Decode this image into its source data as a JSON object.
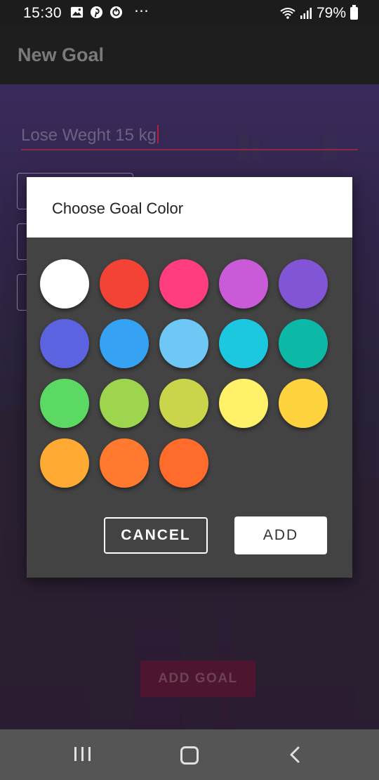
{
  "status_bar": {
    "time": "15:30",
    "dots": "⋯",
    "battery": "79%"
  },
  "app_bar": {
    "title": "New Goal"
  },
  "form": {
    "goal_name_value": "Lose Weght 15 kg",
    "add_goal_label": "ADD GOAL"
  },
  "dialog": {
    "title": "Choose Goal Color",
    "cancel_label": "CANCEL",
    "add_label": "ADD",
    "colors": [
      "#ffffff",
      "#f44336",
      "#ff3d7f",
      "#c95ad8",
      "#8155d6",
      "#5b63e0",
      "#35a2f4",
      "#6ec7f5",
      "#1cc8e0",
      "#0cb8a6",
      "#5bd962",
      "#9dd54f",
      "#cad54a",
      "#fff168",
      "#ffd33d",
      "#ffaa33",
      "#ff7a2f",
      "#ff6b2b"
    ]
  }
}
